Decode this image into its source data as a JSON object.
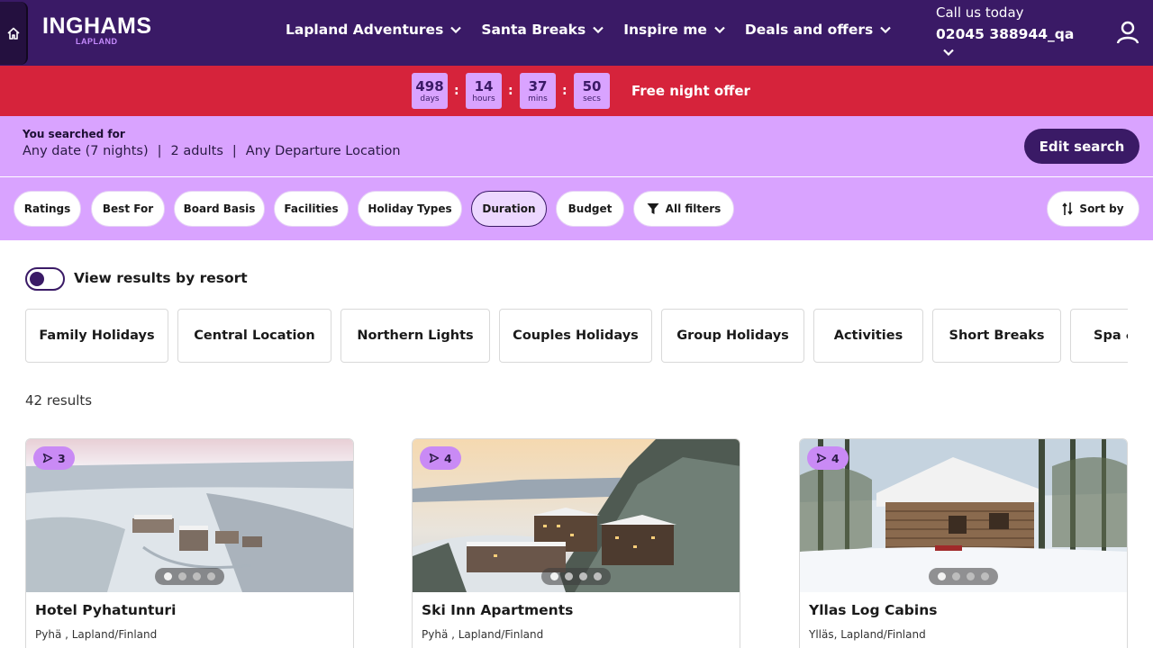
{
  "brand": {
    "name": "INGHAMS",
    "sub": "LAPLAND"
  },
  "nav": [
    {
      "label": "Lapland Adventures"
    },
    {
      "label": "Santa Breaks"
    },
    {
      "label": "Inspire me"
    },
    {
      "label": "Deals and offers"
    }
  ],
  "call": {
    "label": "Call us today",
    "number": "02045 388944_qa"
  },
  "countdown": {
    "days": "498",
    "days_unit": "days",
    "hours": "14",
    "hours_unit": "hours",
    "mins": "37",
    "mins_unit": "mins",
    "secs": "50",
    "secs_unit": "secs",
    "separator": ":",
    "offer_text": "Free night offer"
  },
  "search": {
    "title": "You searched for",
    "date": "Any date (7 nights)",
    "guests": "2 adults",
    "departure": "Any Departure Location",
    "separator": "|",
    "edit_label": "Edit search"
  },
  "filters": {
    "chips": [
      "Ratings",
      "Best For",
      "Board Basis",
      "Facilities",
      "Holiday Types",
      "Duration",
      "Budget"
    ],
    "active": "Duration",
    "all_filters": "All filters",
    "sort": "Sort by"
  },
  "toggle": {
    "label": "View results by resort",
    "on": true
  },
  "themes": [
    "Family Holidays",
    "Central Location",
    "Northern Lights",
    "Couples Holidays",
    "Group Holidays",
    "Activities",
    "Short Breaks",
    "Spa & Wellness"
  ],
  "results": {
    "count_text": "42 results"
  },
  "cards": [
    {
      "name": "Hotel Pyhatunturi",
      "location": "Pyhä , Lapland/Finland",
      "media_count": "3"
    },
    {
      "name": "Ski Inn Apartments",
      "location": "Pyhä , Lapland/Finland",
      "media_count": "4"
    },
    {
      "name": "Yllas Log Cabins",
      "location": "Ylläs, Lapland/Finland",
      "media_count": "4"
    }
  ],
  "colors": {
    "primary": "#3a1a66",
    "lilac": "#d9a3ff",
    "offer": "#d6233b",
    "badge": "#c98af5"
  },
  "icons": [
    "home-icon",
    "chevron-down-icon",
    "user-icon",
    "filter-icon",
    "sort-icon",
    "media-play-icon"
  ]
}
